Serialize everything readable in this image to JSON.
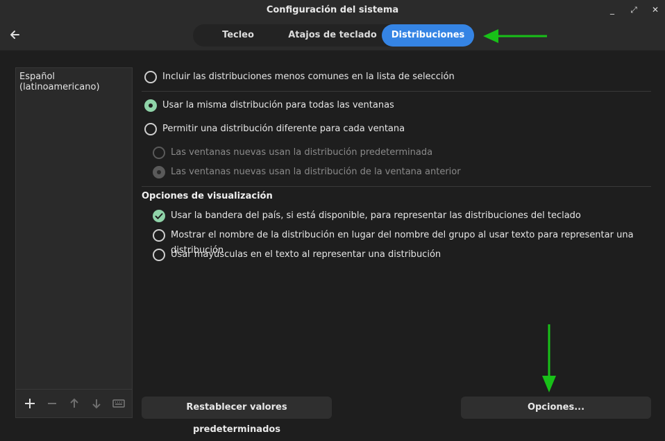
{
  "window": {
    "title": "Configuración del sistema",
    "minimize": "_",
    "maximize": "⤢",
    "close": "✕"
  },
  "tabs": [
    {
      "label": "Tecleo",
      "active": false
    },
    {
      "label": "Atajos de teclado",
      "active": false
    },
    {
      "label": "Distribuciones",
      "active": true
    }
  ],
  "sidebar": {
    "items": [
      {
        "label": "Español (latinoamericano)"
      }
    ],
    "tools": [
      "add-icon",
      "remove-icon",
      "move-up-icon",
      "move-down-icon",
      "keyboard-icon"
    ]
  },
  "options": {
    "include_less_common": "Incluir las distribuciones menos comunes en la lista de selección",
    "same_layout": "Usar la misma distribución para todas las ventanas",
    "different_layout": "Permitir una distribución diferente para cada ventana",
    "new_windows_default": "Las ventanas nuevas usan la distribución predeterminada",
    "new_windows_previous": "Las ventanas nuevas usan la distribución de la ventana anterior"
  },
  "display": {
    "title": "Opciones de visualización",
    "use_flag": "Usar la bandera del país, si está disponible, para representar las distribuciones del teclado",
    "show_layout_name": "Mostrar el nombre de la distribución en lugar del nombre del grupo al usar texto para representar una distribución",
    "use_uppercase": "Usar mayúsculas en el texto al representar una distribución"
  },
  "buttons": {
    "reset": "Restablecer valores predeterminados",
    "options": "Opciones..."
  },
  "colors": {
    "accent": "#3584e4",
    "check": "#8fd3a8",
    "annotation": "#18c018"
  }
}
